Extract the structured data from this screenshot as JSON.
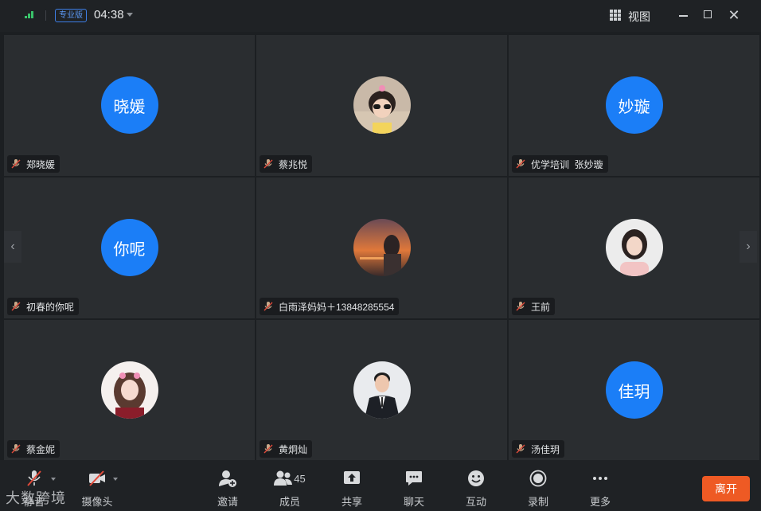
{
  "titlebar": {
    "badge": "专业版",
    "time": "04:38",
    "view_label": "视图",
    "close_glyph": "✕"
  },
  "nav": {
    "prev_glyph": "‹",
    "next_glyph": "›"
  },
  "participants": [
    {
      "name": "郑晓媛",
      "avatar_text": "晓媛"
    },
    {
      "name": "蔡兆悦",
      "avatar_text": ""
    },
    {
      "name": "优学培训  张妙璇",
      "avatar_text": "妙璇"
    },
    {
      "name": "初春的你呢",
      "avatar_text": "你呢"
    },
    {
      "name": "白雨泽妈妈＋13848285554",
      "avatar_text": ""
    },
    {
      "name": "王前",
      "avatar_text": ""
    },
    {
      "name": "蔡金妮",
      "avatar_text": ""
    },
    {
      "name": "黄炯灿",
      "avatar_text": ""
    },
    {
      "name": "汤佳玥",
      "avatar_text": "佳玥"
    }
  ],
  "toolbar": {
    "mute": "静音",
    "camera": "摄像头",
    "invite": "邀请",
    "members": "成员",
    "members_count": "45",
    "share": "共享",
    "chat": "聊天",
    "interact": "互动",
    "record": "录制",
    "more": "更多",
    "leave": "离开"
  },
  "watermark": "大数跨境",
  "colors": {
    "accent_blue": "#1b7ef7",
    "leave_orange": "#ee5a24",
    "signal_green": "#39c26a",
    "muted_red": "#e04a3a"
  }
}
